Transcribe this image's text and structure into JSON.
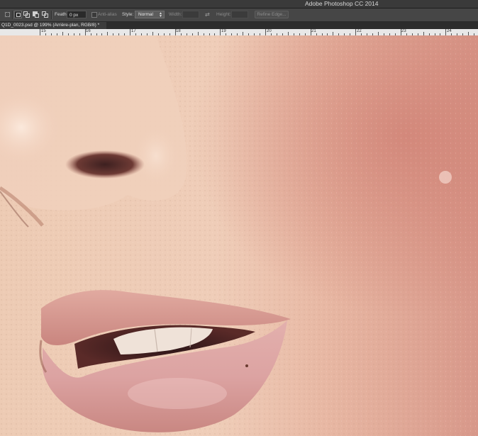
{
  "app": {
    "title": "Adobe Photoshop CC 2014"
  },
  "options_bar": {
    "tool_icons": [
      "marquee-tool-icon",
      "new-selection-icon",
      "add-to-selection-icon",
      "subtract-from-selection-icon",
      "intersect-selection-icon"
    ],
    "feather_label": "Feather:",
    "feather_value": "0 px",
    "anti_alias_label": "Anti-alias",
    "style_label": "Style:",
    "style_value": "Normal",
    "width_label": "Width:",
    "height_label": "Height:",
    "refine_edge_label": "Refine Edge..."
  },
  "document": {
    "tab_label": "Q1D_0023.psd @ 199% (Arrière-plan, RGB/8) *"
  },
  "ruler": {
    "labels": [
      "15",
      "16",
      "17",
      "18",
      "19",
      "20",
      "21",
      "22",
      "23",
      "24"
    ]
  },
  "colors": {
    "skin": "#e9c3ad",
    "cheek": "#d89a86",
    "lips": "#d69a98",
    "ui_bg": "#464646"
  }
}
